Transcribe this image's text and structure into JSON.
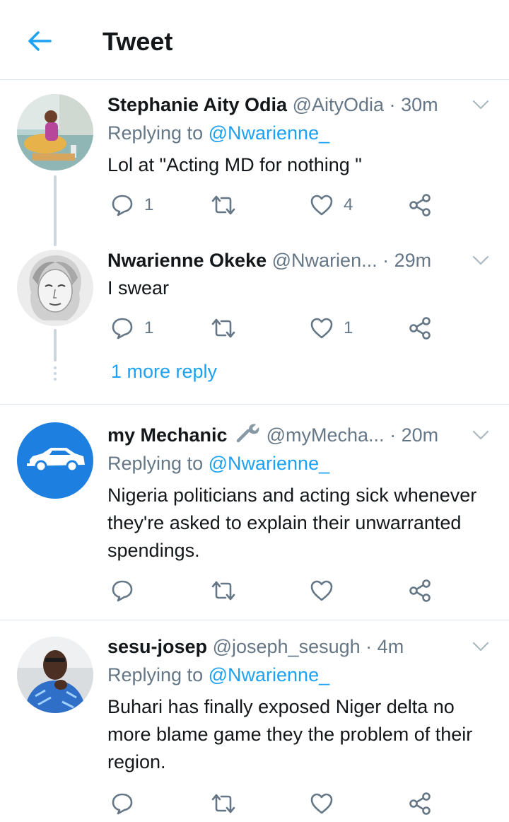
{
  "header": {
    "title": "Tweet",
    "back_icon": "arrow-left-icon",
    "accent": "#1da1f2"
  },
  "tweets": [
    {
      "name": "Stephanie Aity Odia",
      "handle": "@AityOdia",
      "time": "30m",
      "replying_label": "Replying to",
      "replying_to": "@Nwarienne_",
      "text": "Lol at \"Acting MD for nothing \"",
      "replies": "1",
      "retweets": "",
      "likes": "4"
    },
    {
      "name": "Nwarienne Okeke",
      "handle": "@Nwarien...",
      "time": "29m",
      "text": "I swear",
      "replies": "1",
      "retweets": "",
      "likes": "1"
    },
    {
      "name": "my Mechanic",
      "handle": "@myMecha...",
      "time": "20m",
      "replying_label": "Replying to",
      "replying_to": "@Nwarienne_",
      "text": "Nigeria politicians and acting sick whenever they're asked to explain their unwarranted spendings.",
      "replies": "",
      "retweets": "",
      "likes": ""
    },
    {
      "name": "sesu-josep",
      "handle": "@joseph_sesugh",
      "time": "4m",
      "replying_label": "Replying to",
      "replying_to": "@Nwarienne_",
      "text": "Buhari has finally exposed Niger delta no more blame game they the problem of their region.",
      "replies": "",
      "retweets": "",
      "likes": ""
    }
  ],
  "more_replies": "1 more reply",
  "colors": {
    "text": "#14171a",
    "muted": "#657786",
    "link": "#1da1f2",
    "divider": "#e1e8ed",
    "thread": "#ccd6dd"
  }
}
